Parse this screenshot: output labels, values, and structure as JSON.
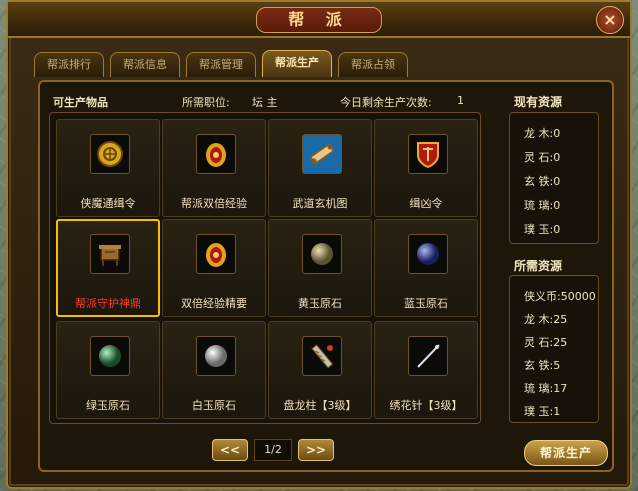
{
  "window": {
    "title": "帮 派"
  },
  "tabs": [
    "帮派排行",
    "帮派信息",
    "帮派管理",
    "帮派生产",
    "帮派占领"
  ],
  "header": {
    "producible_label": "可生产物品",
    "position_label": "所需职位:",
    "position_value": "坛 主",
    "remaining_label": "今日剩余生产次数:",
    "remaining_value": "1"
  },
  "items": [
    {
      "label": "侠魔通缉令",
      "icon": "wanted-token-icon"
    },
    {
      "label": "帮派双倍经验",
      "icon": "double-exp-icon"
    },
    {
      "label": "武道玄机图",
      "icon": "martial-scroll-icon"
    },
    {
      "label": "缉凶令",
      "icon": "hunt-order-icon"
    },
    {
      "label": "帮派守护神鼎",
      "icon": "guardian-cauldron-icon"
    },
    {
      "label": "双倍经验精要",
      "icon": "double-exp-essence-icon"
    },
    {
      "label": "黄玉原石",
      "icon": "yellow-jade-icon"
    },
    {
      "label": "蓝玉原石",
      "icon": "blue-jade-icon"
    },
    {
      "label": "绿玉原石",
      "icon": "green-jade-icon"
    },
    {
      "label": "白玉原石",
      "icon": "white-jade-icon"
    },
    {
      "label": "盘龙柱【3级】",
      "icon": "dragon-pillar-icon"
    },
    {
      "label": "绣花针【3级】",
      "icon": "embroidery-needle-icon"
    }
  ],
  "pager": {
    "prev": "<<",
    "page": "1/2",
    "next": ">>"
  },
  "current_resources": {
    "title": "现有资源",
    "rows": [
      {
        "label": "龙  木:",
        "value": "0"
      },
      {
        "label": "灵  石:",
        "value": "0"
      },
      {
        "label": "玄  铁:",
        "value": "0"
      },
      {
        "label": "琉  璃:",
        "value": "0"
      },
      {
        "label": "璞  玉:",
        "value": "0"
      }
    ]
  },
  "required_resources": {
    "title": "所需资源",
    "rows": [
      {
        "label": "侠义币:",
        "value": "50000"
      },
      {
        "label": "龙  木:",
        "value": "25"
      },
      {
        "label": "灵  石:",
        "value": "25"
      },
      {
        "label": "玄  铁:",
        "value": "5"
      },
      {
        "label": "琉  璃:",
        "value": "17"
      },
      {
        "label": "璞  玉:",
        "value": "1"
      }
    ]
  },
  "produce_button": "帮派生产",
  "close_label": "×"
}
